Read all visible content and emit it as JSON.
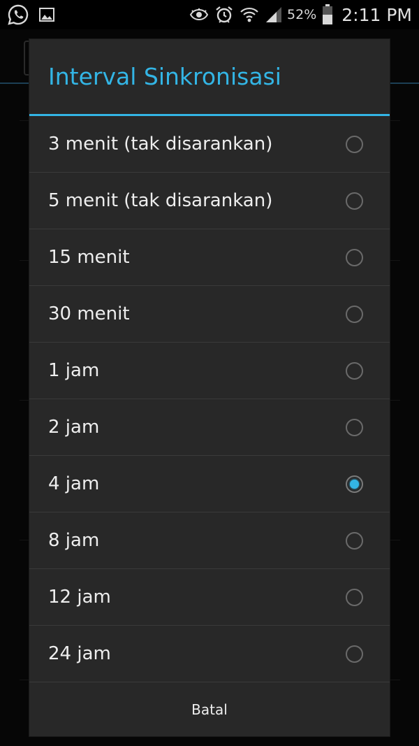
{
  "status_bar": {
    "battery_percent": "52%",
    "time": "2:11 PM",
    "left_icons": [
      "whatsapp-icon",
      "gallery-icon"
    ],
    "right_icons": [
      "eye-icon",
      "alarm-icon",
      "wifi-icon",
      "signal-icon",
      "battery-icon"
    ]
  },
  "dialog": {
    "title": "Interval Sinkronisasi",
    "accent_color": "#33b5e5",
    "options": [
      {
        "label": "3 menit (tak disarankan)",
        "selected": false
      },
      {
        "label": "5 menit (tak disarankan)",
        "selected": false
      },
      {
        "label": "15 menit",
        "selected": false
      },
      {
        "label": "30 menit",
        "selected": false
      },
      {
        "label": "1 jam",
        "selected": false
      },
      {
        "label": "2 jam",
        "selected": false
      },
      {
        "label": "4 jam",
        "selected": true
      },
      {
        "label": "8 jam",
        "selected": false
      },
      {
        "label": "12 jam",
        "selected": false
      },
      {
        "label": "24 jam",
        "selected": false
      }
    ],
    "cancel_label": "Batal"
  }
}
